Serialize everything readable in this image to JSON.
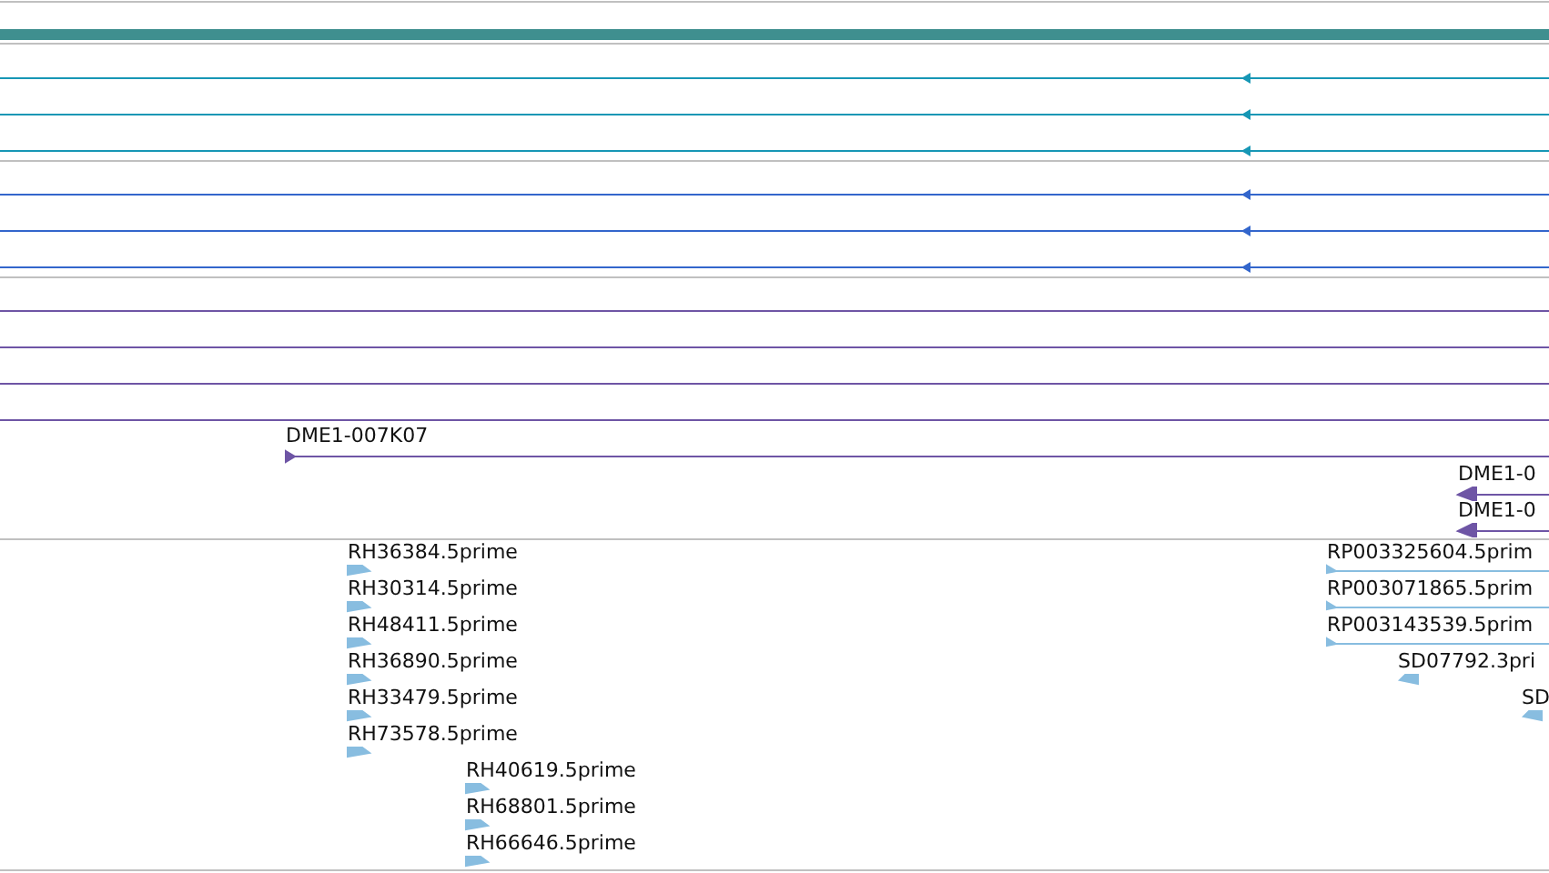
{
  "clone_features": [
    {
      "label": "DME1-007K07",
      "reverse": false
    },
    {
      "label": "DME1-0",
      "reverse": true
    },
    {
      "label": "DME1-0",
      "reverse": true
    }
  ],
  "est_features": [
    {
      "label": "RH36384.5prime",
      "reverse": false
    },
    {
      "label": "RH30314.5prime",
      "reverse": false
    },
    {
      "label": "RH48411.5prime",
      "reverse": false
    },
    {
      "label": "RH36890.5prime",
      "reverse": false
    },
    {
      "label": "RH33479.5prime",
      "reverse": false
    },
    {
      "label": "RH73578.5prime",
      "reverse": false
    },
    {
      "label": "RH40619.5prime",
      "reverse": false
    },
    {
      "label": "RH68801.5prime",
      "reverse": false
    },
    {
      "label": "RH66646.5prime",
      "reverse": false
    },
    {
      "label": "RP003325604.5prim",
      "reverse": false
    },
    {
      "label": "RP003071865.5prim",
      "reverse": false
    },
    {
      "label": "RP003143539.5prim",
      "reverse": false
    },
    {
      "label": "SD07792.3pri",
      "reverse": true
    },
    {
      "label": "SD",
      "reverse": true
    }
  ]
}
